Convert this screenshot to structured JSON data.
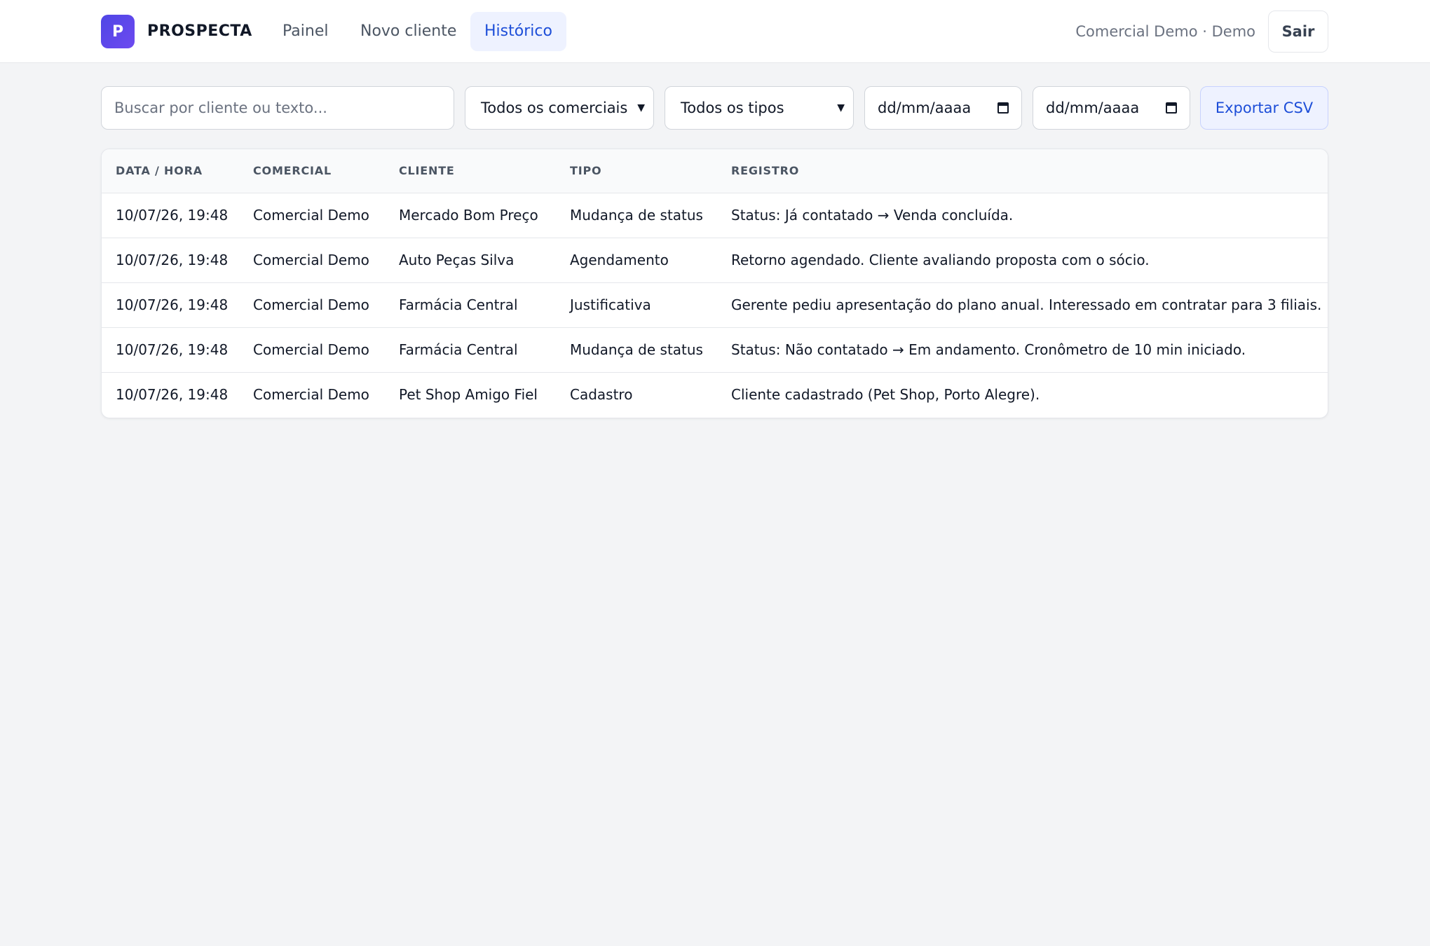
{
  "brand": {
    "logo_letter": "P",
    "name": "PROSPECTA"
  },
  "nav": {
    "items": [
      {
        "label": "Painel"
      },
      {
        "label": "Novo cliente"
      },
      {
        "label": "Histórico",
        "active": true
      }
    ]
  },
  "user": {
    "label": "Comercial Demo · Demo",
    "logout_label": "Sair"
  },
  "filters": {
    "search_placeholder": "Buscar por cliente ou texto...",
    "comercial_select": "Todos os comerciais",
    "tipo_select": "Todos os tipos",
    "date_from": "dd/mm/aaaa",
    "date_to": "dd/mm/aaaa",
    "export_label": "Exportar CSV"
  },
  "table": {
    "headers": [
      "DATA / HORA",
      "COMERCIAL",
      "CLIENTE",
      "TIPO",
      "REGISTRO"
    ],
    "rows": [
      [
        "10/07/26, 19:48",
        "Comercial Demo",
        "Mercado Bom Preço",
        "Mudança de status",
        "Status: Já contatado → Venda concluída."
      ],
      [
        "10/07/26, 19:48",
        "Comercial Demo",
        "Auto Peças Silva",
        "Agendamento",
        "Retorno agendado. Cliente avaliando proposta com o sócio."
      ],
      [
        "10/07/26, 19:48",
        "Comercial Demo",
        "Farmácia Central",
        "Justificativa",
        "Gerente pediu apresentação do plano anual. Interessado em contratar para 3 filiais."
      ],
      [
        "10/07/26, 19:48",
        "Comercial Demo",
        "Farmácia Central",
        "Mudança de status",
        "Status: Não contatado → Em andamento. Cronômetro de 10 min iniciado."
      ],
      [
        "10/07/26, 19:48",
        "Comercial Demo",
        "Pet Shop Amigo Fiel",
        "Cadastro",
        "Cliente cadastrado (Pet Shop, Porto Alegre)."
      ]
    ]
  },
  "colors": {
    "accent": "#1d4ed8",
    "brand_gradient_start": "#4f46e5",
    "brand_gradient_end": "#6d4af0",
    "background": "#f3f4f6"
  }
}
